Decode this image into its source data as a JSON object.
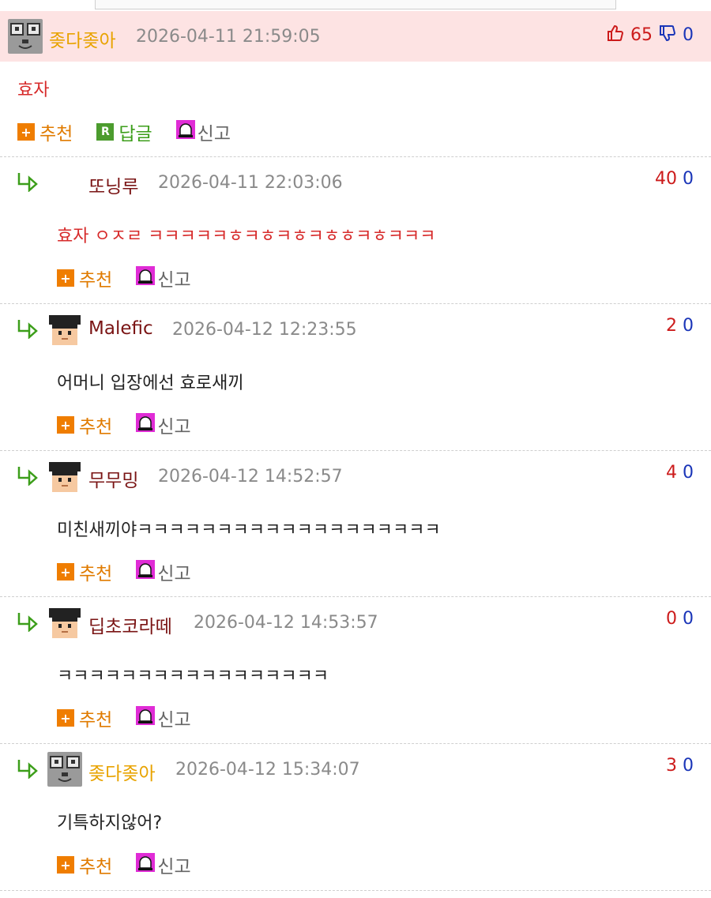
{
  "comments": [
    {
      "nick": "좆다좆아",
      "date": "2026-04-11 21:59:05",
      "up": "65",
      "down": "0",
      "text": "효자",
      "recommend_label": "추천",
      "reply_label": "답글",
      "report_label": "신고"
    },
    {
      "nick": "또닝루",
      "date": "2026-04-11 22:03:06",
      "up": "40",
      "down": "0",
      "text": "효자 ㅇㅈㄹ ㅋㅋㅋㅋㅋㅎㅋㅎㅋㅎㅋㅎㅎㅋㅎㅋㅋㅋ",
      "recommend_label": "추천",
      "report_label": "신고"
    },
    {
      "nick": "Malefic",
      "date": "2026-04-12 12:23:55",
      "up": "2",
      "down": "0",
      "text": "어머니 입장에선 효로새끼",
      "recommend_label": "추천",
      "report_label": "신고"
    },
    {
      "nick": "무무밍",
      "date": "2026-04-12 14:52:57",
      "up": "4",
      "down": "0",
      "text": "미친새끼야ㅋㅋㅋㅋㅋㅋㅋㅋㅋㅋㅋㅋㅋㅋㅋㅋㅋㅋㅋ",
      "recommend_label": "추천",
      "report_label": "신고"
    },
    {
      "nick": "딥초코라떼",
      "date": "2026-04-12 14:53:57",
      "up": "0",
      "down": "0",
      "text": "ㅋㅋㅋㅋㅋㅋㅋㅋㅋㅋㅋㅋㅋㅋㅋㅋㅋ",
      "recommend_label": "추천",
      "report_label": "신고"
    },
    {
      "nick": "좆다좆아",
      "date": "2026-04-12 15:34:07",
      "up": "3",
      "down": "0",
      "text": "기특하지않어?",
      "recommend_label": "추천",
      "report_label": "신고"
    }
  ]
}
